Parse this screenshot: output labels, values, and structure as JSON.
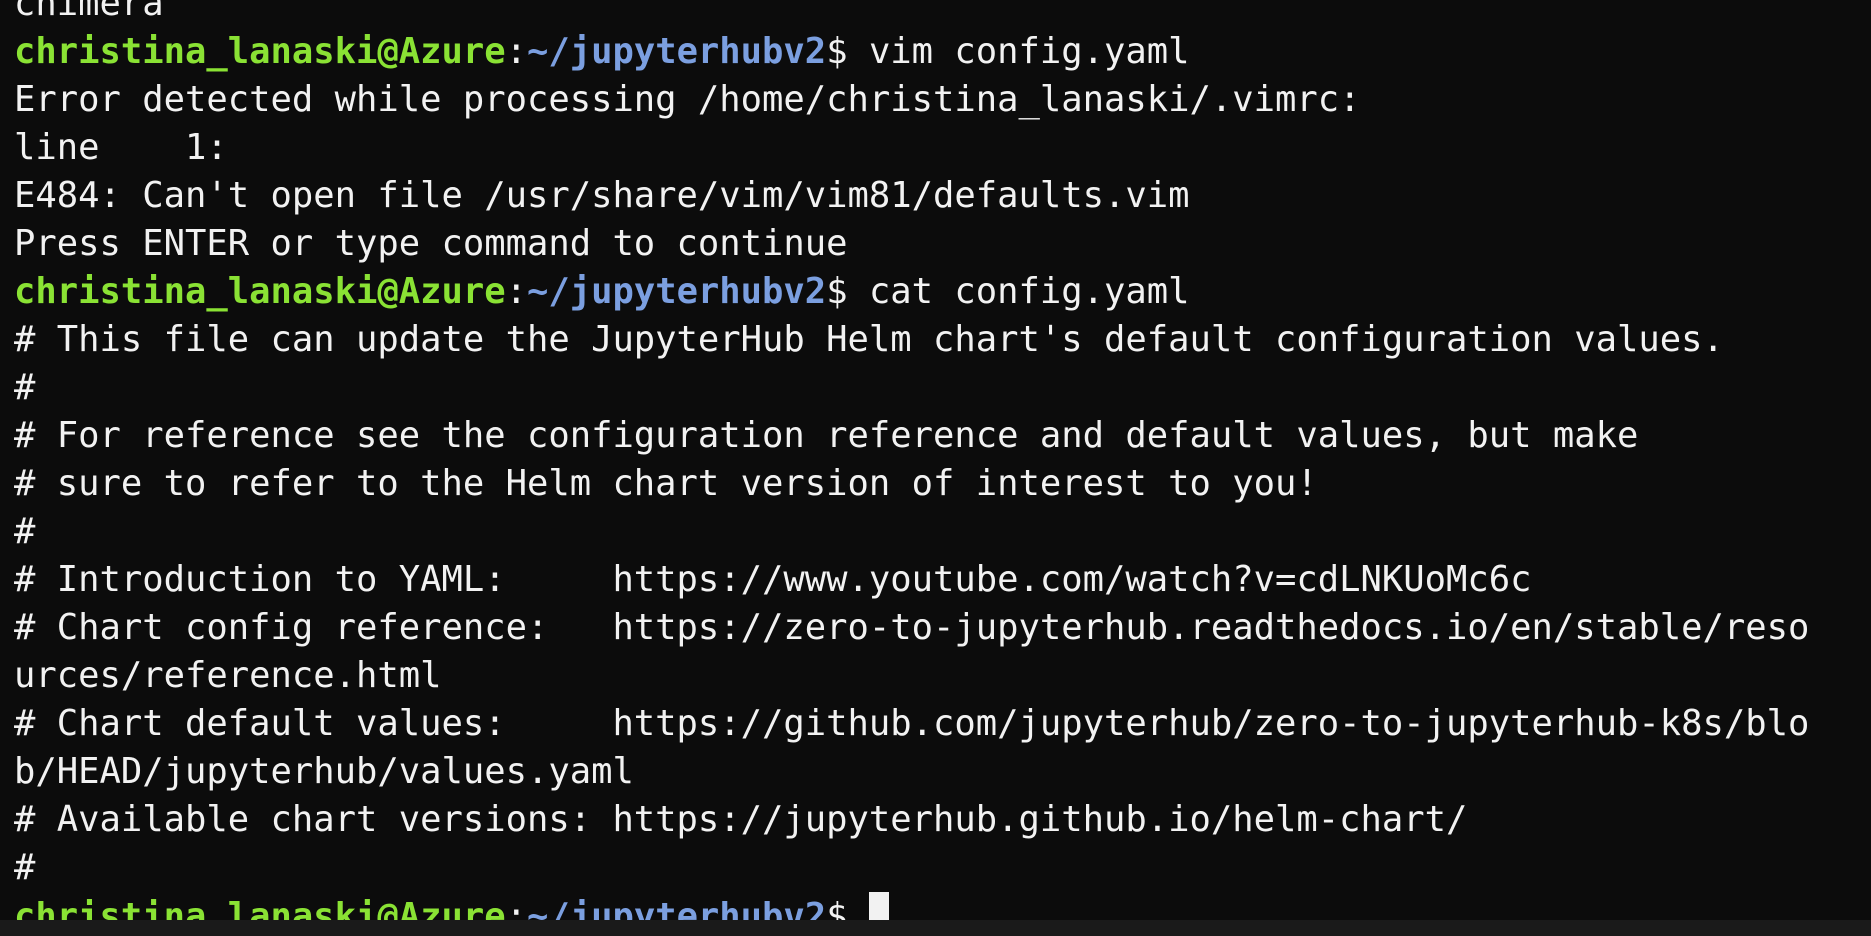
{
  "prompt": {
    "user_host": "christina_lanaski@Azure",
    "separator": ":",
    "path": "~/jupyterhubv2",
    "symbol": "$ "
  },
  "lines": [
    {
      "kind": "output",
      "text": "chimera"
    },
    {
      "kind": "prompt",
      "command": "vim config.yaml"
    },
    {
      "kind": "output",
      "text": "Error detected while processing /home/christina_lanaski/.vimrc:"
    },
    {
      "kind": "output",
      "text": "line    1:"
    },
    {
      "kind": "output",
      "text": "E484: Can't open file /usr/share/vim/vim81/defaults.vim"
    },
    {
      "kind": "output",
      "text": "Press ENTER or type command to continue"
    },
    {
      "kind": "prompt",
      "command": "cat config.yaml"
    },
    {
      "kind": "output",
      "text": "# This file can update the JupyterHub Helm chart's default configuration values."
    },
    {
      "kind": "output",
      "text": "#"
    },
    {
      "kind": "output",
      "text": "# For reference see the configuration reference and default values, but make"
    },
    {
      "kind": "output",
      "text": "# sure to refer to the Helm chart version of interest to you!"
    },
    {
      "kind": "output",
      "text": "#"
    },
    {
      "kind": "output",
      "text": "# Introduction to YAML:     https://www.youtube.com/watch?v=cdLNKUoMc6c"
    },
    {
      "kind": "output",
      "text": "# Chart config reference:   https://zero-to-jupyterhub.readthedocs.io/en/stable/reso"
    },
    {
      "kind": "output",
      "text": "urces/reference.html"
    },
    {
      "kind": "output",
      "text": "# Chart default values:     https://github.com/jupyterhub/zero-to-jupyterhub-k8s/blo"
    },
    {
      "kind": "output",
      "text": "b/HEAD/jupyterhub/values.yaml"
    },
    {
      "kind": "output",
      "text": "# Available chart versions: https://jupyterhub.github.io/helm-chart/"
    },
    {
      "kind": "output",
      "text": "#"
    },
    {
      "kind": "prompt",
      "command": "",
      "cursor": true
    }
  ]
}
